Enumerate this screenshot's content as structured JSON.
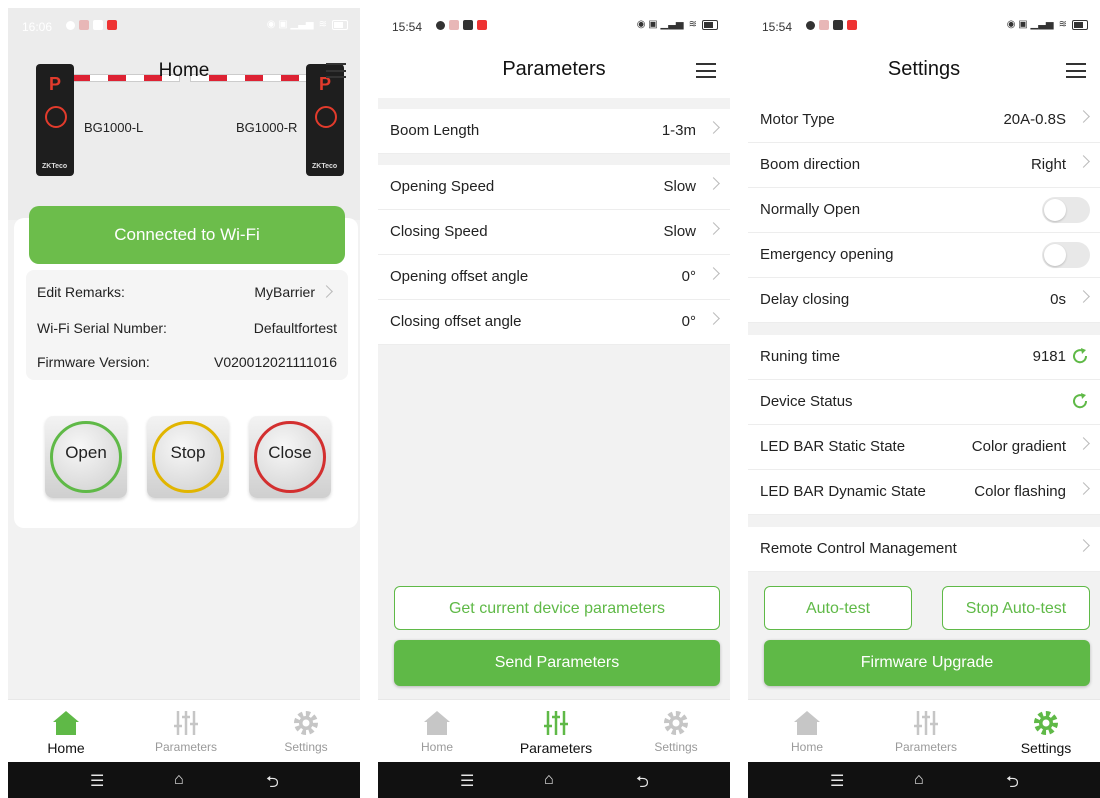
{
  "status": [
    {
      "time": "16:06"
    },
    {
      "time": "15:54"
    },
    {
      "time": "15:54"
    }
  ],
  "tabs": {
    "home": "Home",
    "parameters": "Parameters",
    "settings": "Settings"
  },
  "colors": {
    "accent": "#5fb947",
    "danger": "#d32f2f",
    "warn": "#e1b500"
  },
  "home": {
    "title": "Home",
    "left_device": "BG1000-L",
    "right_device": "BG1000-R",
    "wifi_button": "Connected to Wi-Fi",
    "info": [
      {
        "key": "Edit Remarks:",
        "value": "MyBarrier"
      },
      {
        "key": "Wi-Fi Serial Number:",
        "value": "Defaultfortest"
      },
      {
        "key": "Firmware Version:",
        "value": "V020012021111016"
      }
    ],
    "buttons": {
      "open": "Open",
      "stop": "Stop",
      "close": "Close"
    }
  },
  "parameters": {
    "title": "Parameters",
    "rows": [
      {
        "label": "Boom Length",
        "value": "1-3m"
      },
      {
        "label": "Opening Speed",
        "value": "Slow"
      },
      {
        "label": "Closing Speed",
        "value": "Slow"
      },
      {
        "label": "Opening offset angle",
        "value": "0°"
      },
      {
        "label": "Closing offset angle",
        "value": "0°"
      }
    ],
    "get_button": "Get current device parameters",
    "send_button": "Send Parameters"
  },
  "settings": {
    "title": "Settings",
    "rows": [
      {
        "label": "Motor Type",
        "value": "20A-0.8S"
      },
      {
        "label": "Boom direction",
        "value": "Right"
      },
      {
        "label": "Normally Open",
        "value": ""
      },
      {
        "label": "Emergency opening",
        "value": ""
      },
      {
        "label": "Delay closing",
        "value": "0s"
      },
      {
        "label": "Runing time",
        "value": "9181"
      },
      {
        "label": "Device Status",
        "value": ""
      },
      {
        "label": "LED BAR Static State",
        "value": "Color gradient"
      },
      {
        "label": "LED BAR Dynamic State",
        "value": "Color flashing"
      },
      {
        "label": "Remote Control Management",
        "value": ""
      }
    ],
    "autotest_button": "Auto-test",
    "stop_autotest_button": "Stop Auto-test",
    "firmware_button": "Firmware Upgrade"
  }
}
